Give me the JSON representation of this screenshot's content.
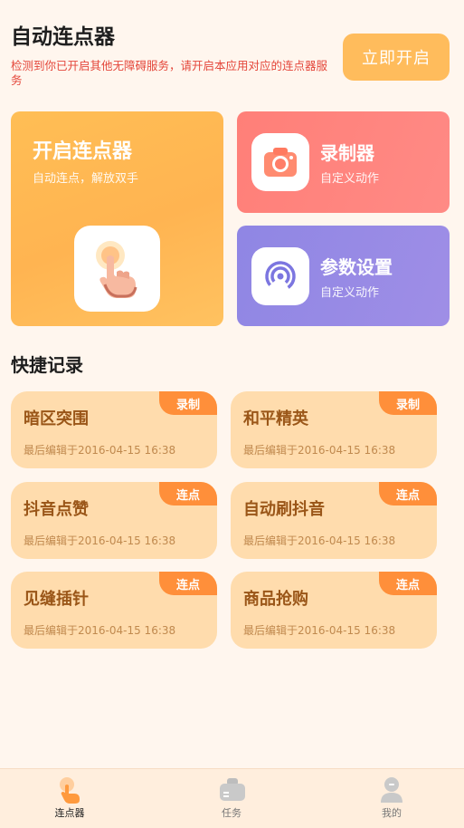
{
  "header": {
    "title": "自动连点器",
    "warning": "检测到你已开启其他无障碍服务，请开启本应用对应的连点器服务",
    "start_button": "立即开启"
  },
  "cards": {
    "main": {
      "title": "开启连点器",
      "subtitle": "自动连点，解放双手",
      "icon": "tap-hand-icon"
    },
    "recorder": {
      "title": "录制器",
      "subtitle": "自定义动作",
      "icon": "camera-icon"
    },
    "settings": {
      "title": "参数设置",
      "subtitle": "自定义动作",
      "icon": "signal-icon"
    }
  },
  "quick_records": {
    "title": "快捷记录",
    "items": [
      {
        "name": "暗区突围",
        "tag": "录制",
        "time": "最后编辑于2016-04-15 16:38"
      },
      {
        "name": "和平精英",
        "tag": "录制",
        "time": "最后编辑于2016-04-15 16:38"
      },
      {
        "name": "抖音点赞",
        "tag": "连点",
        "time": "最后编辑于2016-04-15 16:38"
      },
      {
        "name": "自动刷抖音",
        "tag": "连点",
        "time": "最后编辑于2016-04-15 16:38"
      },
      {
        "name": "见缝插针",
        "tag": "连点",
        "time": "最后编辑于2016-04-15 16:38"
      },
      {
        "name": "商品抢购",
        "tag": "连点",
        "time": "最后编辑于2016-04-15 16:38"
      }
    ]
  },
  "tabbar": {
    "items": [
      {
        "label": "连点器",
        "icon": "tap-hand-icon",
        "active": true
      },
      {
        "label": "任务",
        "icon": "briefcase-icon",
        "active": false
      },
      {
        "label": "我的",
        "icon": "user-icon",
        "active": false
      }
    ]
  },
  "colors": {
    "accent": "#ffbc5c",
    "warning": "#e4473b",
    "recorder": "#ff7f78",
    "settings": "#8f86e4",
    "record_card": "#ffdcad",
    "tag": "#ff8f3a"
  }
}
